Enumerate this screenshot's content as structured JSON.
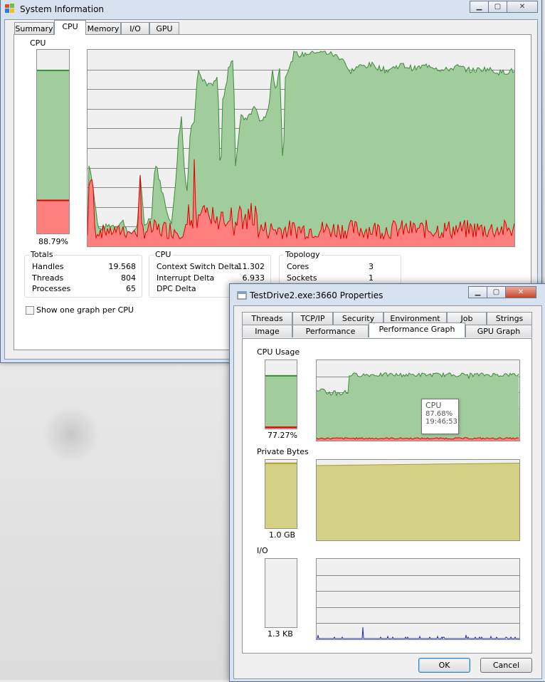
{
  "sysinfo": {
    "title": "System Information",
    "tabs": [
      "Summary",
      "CPU",
      "Memory",
      "I/O",
      "GPU"
    ],
    "active_tab": "CPU",
    "cpu_label": "CPU",
    "cpu_percent": "88.79%",
    "cpu_fraction": 0.8879,
    "totals": {
      "title": "Totals",
      "rows": [
        {
          "label": "Handles",
          "value": "19.568"
        },
        {
          "label": "Threads",
          "value": "804"
        },
        {
          "label": "Processes",
          "value": "65"
        }
      ]
    },
    "cpu_group": {
      "title": "CPU",
      "rows": [
        {
          "label": "Context Switch Delta",
          "value": "11.302"
        },
        {
          "label": "Interrupt Delta",
          "value": "6.933"
        },
        {
          "label": "DPC Delta",
          "value": ""
        }
      ]
    },
    "topology": {
      "title": "Topology",
      "rows": [
        {
          "label": "Cores",
          "value": "3"
        },
        {
          "label": "Sockets",
          "value": "1"
        }
      ]
    },
    "checkbox_label": "Show one graph per CPU"
  },
  "props": {
    "title": "TestDrive2.exe:3660 Properties",
    "tabs_row1": [
      "Threads",
      "TCP/IP",
      "Security",
      "Environment",
      "Job",
      "Strings"
    ],
    "tabs_row2": [
      "Image",
      "Performance",
      "Performance Graph",
      "GPU Graph"
    ],
    "active_tab": "Performance Graph",
    "cpu_usage_label": "CPU Usage",
    "cpu_usage_value": "77.27%",
    "cpu_usage_fraction": 0.7727,
    "private_bytes_label": "Private Bytes",
    "private_bytes_value": "1.0 GB",
    "private_bytes_fraction": 0.95,
    "io_label": "I/O",
    "io_value": "1.3  KB",
    "tooltip": {
      "title": "CPU",
      "value": "87.68%",
      "time": "19:46:53"
    },
    "ok_label": "OK",
    "cancel_label": "Cancel"
  },
  "colors": {
    "cpu_fill": "#a1cc9c",
    "cpu_line": "#3d8b3a",
    "kernel_fill": "#ff7f7f",
    "kernel_line": "#e00000",
    "bytes_fill": "#d4d184",
    "bytes_line": "#a8a030",
    "io_line": "#1f2fa8"
  }
}
